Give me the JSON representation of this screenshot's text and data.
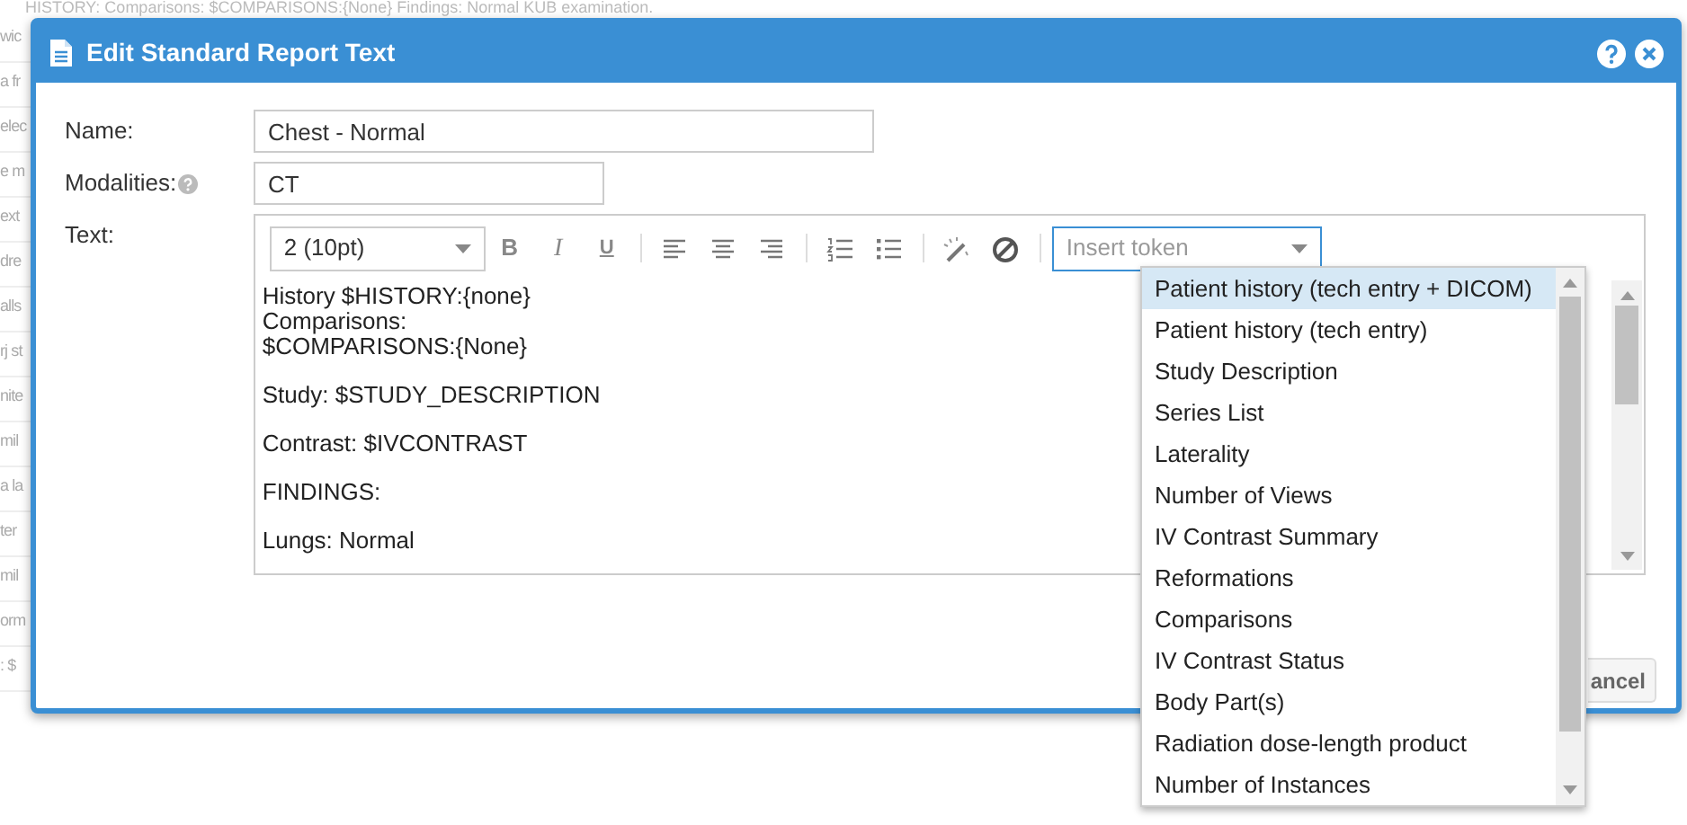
{
  "background": {
    "header_text": "HISTORY: Comparisons: $COMPARISONS:{None} Findings: Normal KUB examination.",
    "row_fragments": [
      "wic",
      "a fr",
      "elec",
      "e m",
      "ext",
      "dre",
      "alls",
      "rj st",
      "nite",
      "mil",
      "a la",
      "ter",
      "mil",
      "orm",
      ": $"
    ]
  },
  "dialog": {
    "title": "Edit Standard Report Text",
    "fields": [
      {
        "label": "Name:",
        "value": "Chest - Normal",
        "help": false
      },
      {
        "label": "Modalities:",
        "value": "CT",
        "help": true
      }
    ],
    "text_label": "Text:",
    "toolbar": {
      "font_size": "2 (10pt)",
      "buttons": [
        {
          "kind": "bold",
          "label": "B"
        },
        {
          "kind": "italic",
          "label": "I"
        },
        {
          "kind": "underline",
          "label": "U"
        },
        {
          "kind": "separator"
        },
        {
          "kind": "align-left"
        },
        {
          "kind": "align-center"
        },
        {
          "kind": "align-right"
        },
        {
          "kind": "separator"
        },
        {
          "kind": "ordered-list"
        },
        {
          "kind": "bullet-list"
        },
        {
          "kind": "separator"
        },
        {
          "kind": "magic-wand"
        },
        {
          "kind": "clear"
        },
        {
          "kind": "separator"
        }
      ],
      "token_placeholder": "Insert token"
    },
    "content": [
      [
        "History $HISTORY:{none}",
        "Comparisons:",
        "$COMPARISONS:{None}"
      ],
      [
        "Study: $STUDY_DESCRIPTION"
      ],
      [
        "Contrast: $IVCONTRAST"
      ],
      [
        "FINDINGS:"
      ],
      [
        "Lungs: Normal"
      ]
    ],
    "buttons": [
      "ancel"
    ],
    "token_list": [
      {
        "label": "Patient history (tech entry + DICOM)",
        "selected": true
      },
      {
        "label": "Patient history (tech entry)",
        "selected": false
      },
      {
        "label": "Study Description",
        "selected": false
      },
      {
        "label": "Series List",
        "selected": false
      },
      {
        "label": "Laterality",
        "selected": false
      },
      {
        "label": "Number of Views",
        "selected": false
      },
      {
        "label": "IV Contrast Summary",
        "selected": false
      },
      {
        "label": "Reformations",
        "selected": false
      },
      {
        "label": "Comparisons",
        "selected": false
      },
      {
        "label": "IV Contrast Status",
        "selected": false
      },
      {
        "label": "Body Part(s)",
        "selected": false
      },
      {
        "label": "Radiation dose-length product",
        "selected": false
      },
      {
        "label": "Number of Instances",
        "selected": false
      }
    ]
  }
}
